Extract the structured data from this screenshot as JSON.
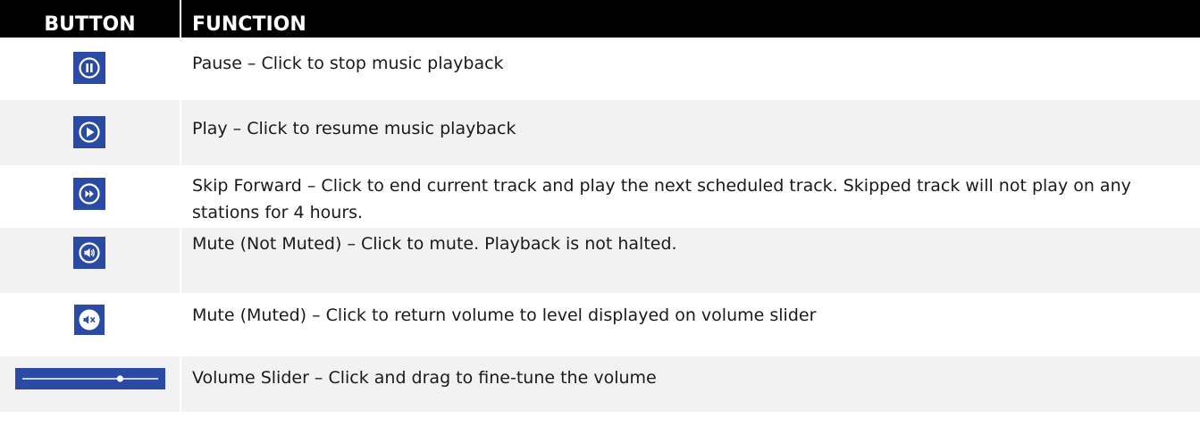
{
  "table": {
    "headers": {
      "button": "BUTTON",
      "function": "FUNCTION"
    },
    "accent_color": "#2b4aa3",
    "rows": [
      {
        "icon": "pause-icon",
        "description": "Pause – Click to stop music playback"
      },
      {
        "icon": "play-icon",
        "description": "Play – Click to resume music playback"
      },
      {
        "icon": "skip-forward-icon",
        "description": "Skip Forward – Click to end current track and play the next scheduled track. Skipped track will not play on any stations for 4 hours."
      },
      {
        "icon": "volume-icon",
        "description": "Mute (Not Muted) – Click to mute. Playback is not halted."
      },
      {
        "icon": "muted-icon",
        "description": "Mute (Muted) – Click to return volume to level displayed on volume slider"
      },
      {
        "icon": "volume-slider",
        "description": "Volume Slider – Click and drag to fine-tune the volume",
        "slider_level": 0.72
      }
    ]
  }
}
